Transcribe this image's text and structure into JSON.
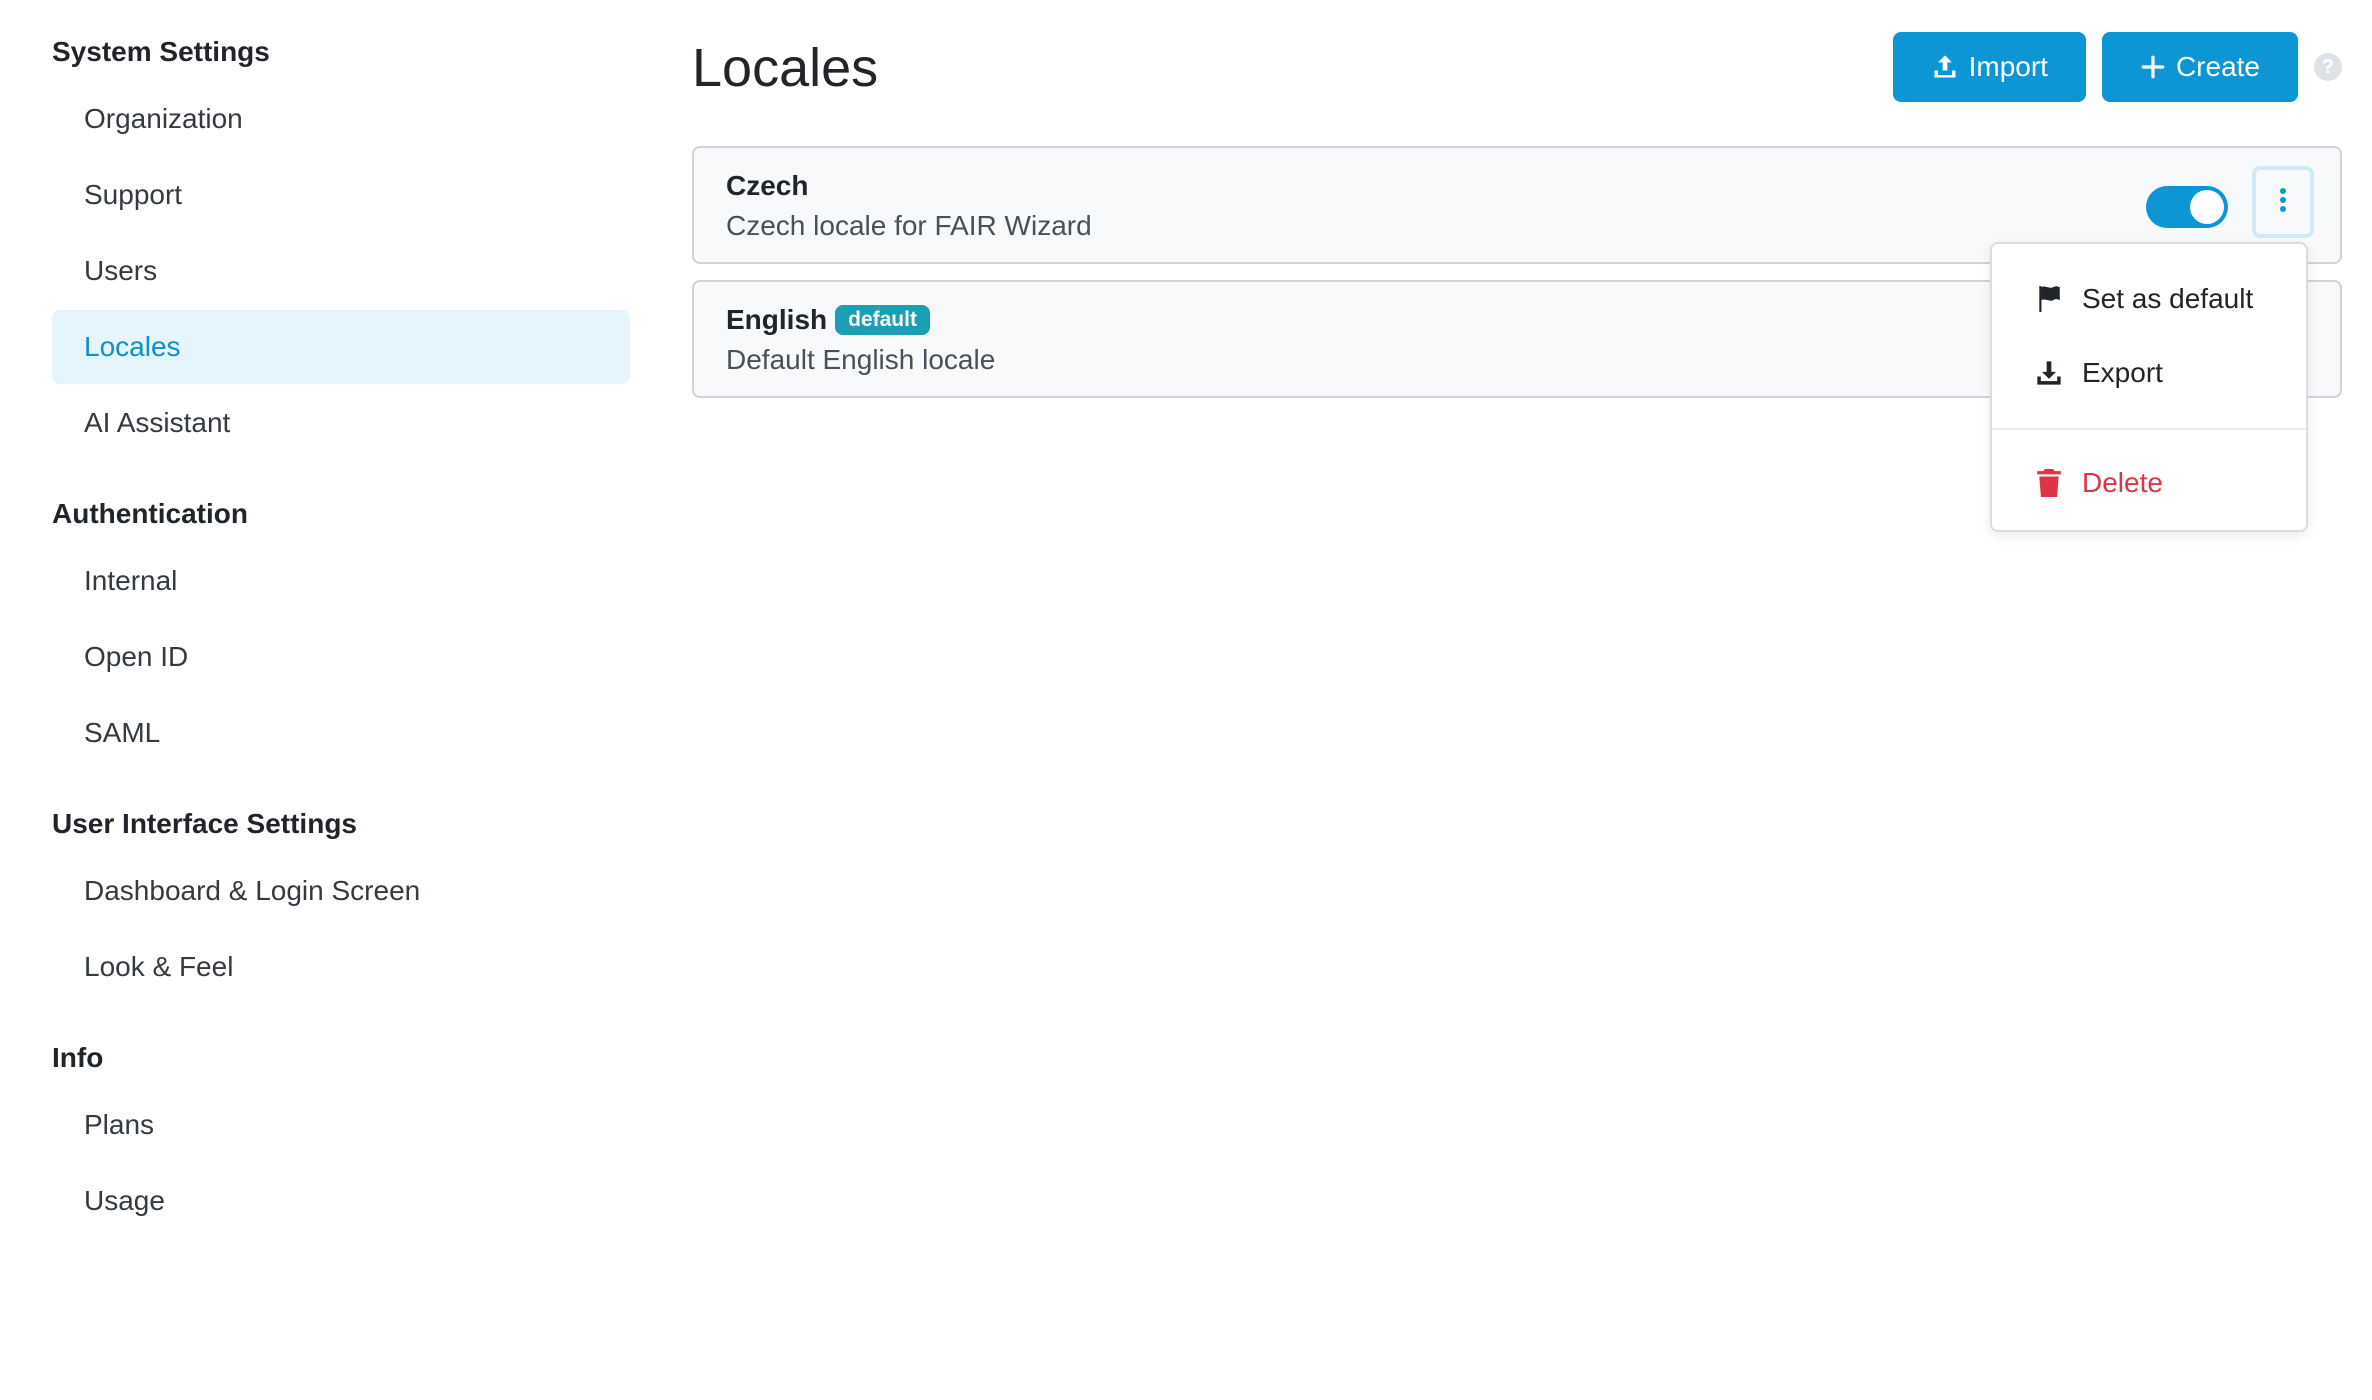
{
  "sidebar": {
    "groups": [
      {
        "heading": "System Settings",
        "items": [
          "Organization",
          "Support",
          "Users",
          "Locales",
          "AI Assistant"
        ]
      },
      {
        "heading": "Authentication",
        "items": [
          "Internal",
          "Open ID",
          "SAML"
        ]
      },
      {
        "heading": "User Interface Settings",
        "items": [
          "Dashboard & Login Screen",
          "Look & Feel"
        ]
      },
      {
        "heading": "Info",
        "items": [
          "Plans",
          "Usage"
        ]
      }
    ],
    "active_item": "Locales"
  },
  "header": {
    "title": "Locales",
    "import_label": "Import",
    "create_label": "Create",
    "help_label": "?"
  },
  "locales": [
    {
      "name": "Czech",
      "description": "Czech locale for FAIR Wizard",
      "badge": "",
      "enabled": true
    },
    {
      "name": "English",
      "description": "Default English locale",
      "badge": "default"
    }
  ],
  "menu": {
    "set_default_label": "Set as default",
    "export_label": "Export",
    "delete_label": "Delete"
  },
  "colors": {
    "accent": "#0d96d6",
    "active_bg": "#e6f4fb",
    "badge": "#1a9fb5",
    "danger": "#dc3545"
  }
}
